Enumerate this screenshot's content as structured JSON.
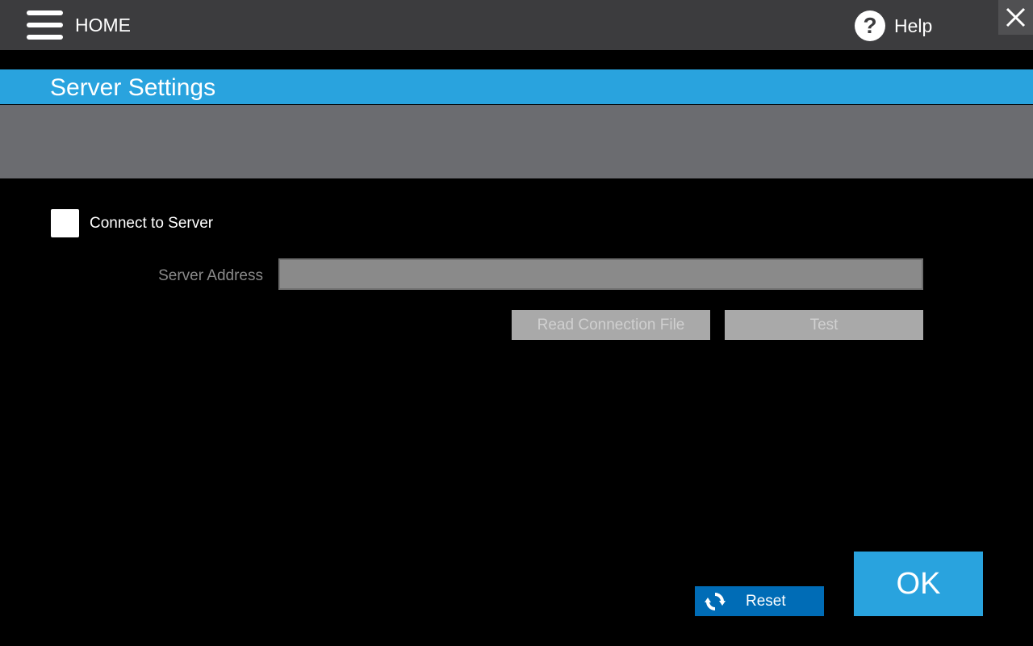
{
  "header": {
    "home_label": "HOME",
    "help_label": "Help",
    "help_icon_glyph": "?"
  },
  "page": {
    "title": "Server Settings"
  },
  "form": {
    "connect_checkbox_label": "Connect to Server",
    "connect_checked": false,
    "server_address_label": "Server Address",
    "server_address_value": "",
    "read_connection_file_label": "Read Connection File",
    "test_label": "Test"
  },
  "footer": {
    "reset_label": "Reset",
    "ok_label": "OK"
  },
  "icons": {
    "menu": "hamburger-menu-icon",
    "help": "question-circle-icon",
    "close": "close-icon",
    "reset": "refresh-icon"
  },
  "colors": {
    "accent": "#29a3de",
    "reset_button": "#006cb6",
    "topbar": "#3c3c3e",
    "band": "#6b6c70",
    "disabled": "#a9a9a9"
  }
}
